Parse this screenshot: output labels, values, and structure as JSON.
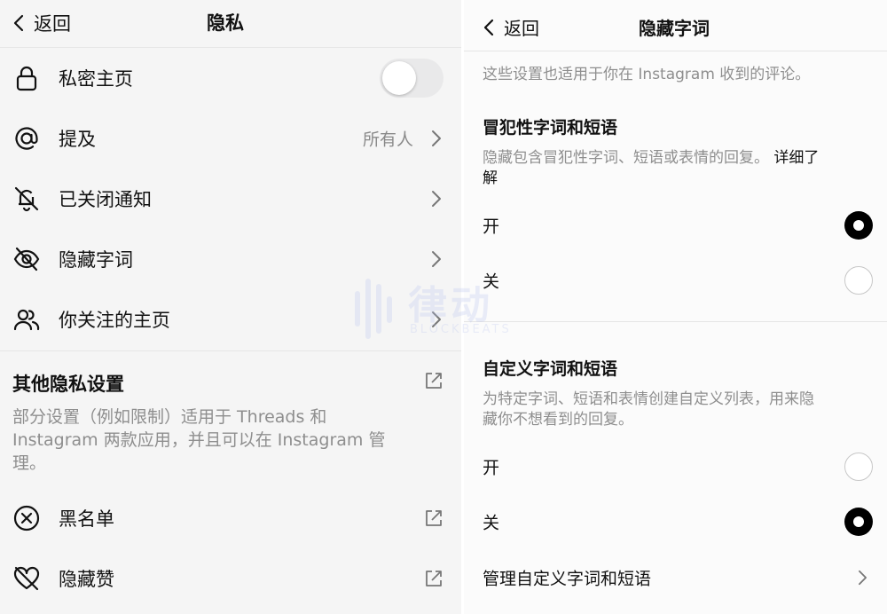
{
  "privacy": {
    "back_label": "返回",
    "title": "隐私",
    "rows": [
      {
        "label": "私密主页",
        "toggle_on": false
      },
      {
        "label": "提及",
        "value": "所有人"
      },
      {
        "label": "已关闭通知"
      },
      {
        "label": "隐藏字词"
      },
      {
        "label": "你关注的主页"
      }
    ],
    "other": {
      "title": "其他隐私设置",
      "desc_line1": "部分设置（例如限制）适用于 Threads 和",
      "desc_line2": "Instagram 两款应用，并且可以在 Instagram 管",
      "desc_line3": "理。"
    },
    "bottom_rows": [
      {
        "label": "黑名单"
      },
      {
        "label": "隐藏赞"
      }
    ]
  },
  "hidden_words": {
    "back_label": "返回",
    "title": "隐藏字词",
    "intro": "这些设置也适用于你在 Instagram 收到的评论。",
    "offensive": {
      "title": "冒犯性字词和短语",
      "desc_line1": "隐藏包含冒犯性字词、短语或表情的回复。",
      "learn_more_line1": "详细了",
      "learn_more_line2": "解",
      "on_label": "开",
      "off_label": "关",
      "selected": "on"
    },
    "custom": {
      "title": "自定义字词和短语",
      "desc_line1": "为特定字词、短语和表情创建自定义列表，用来隐",
      "desc_line2": "藏你不想看到的回复。",
      "on_label": "开",
      "off_label": "关",
      "selected": "off"
    },
    "manage_label": "管理自定义字词和短语"
  },
  "watermark": {
    "main": "律动",
    "sub": "BLOCKBEATS"
  }
}
